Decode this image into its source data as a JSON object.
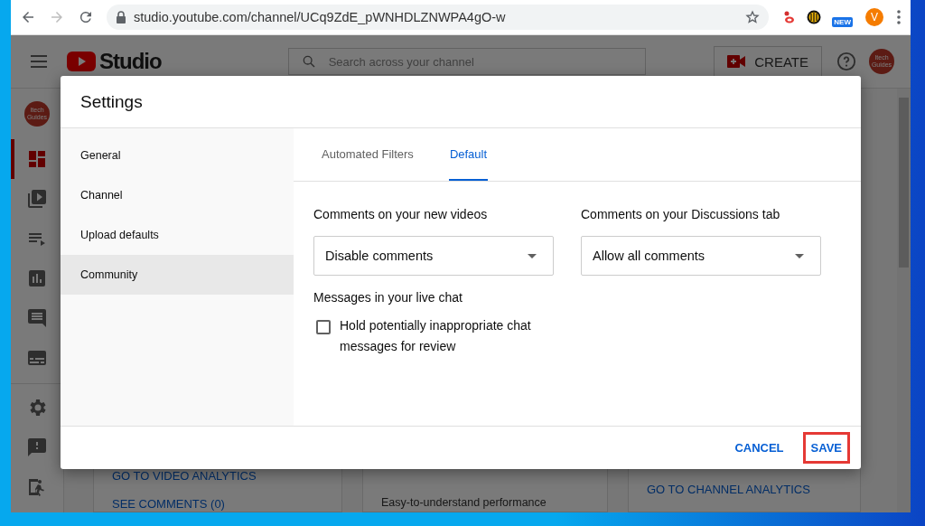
{
  "browser": {
    "url": "studio.youtube.com/channel/UCq9ZdE_pWNHDLZNWPA4gO-w",
    "extension_badge": "NEW",
    "profile_initial": "V"
  },
  "studio": {
    "logo": "Studio",
    "search": {
      "placeholder": "Search across your channel"
    },
    "create_button": "CREATE",
    "avatar_lines": [
      "Itech",
      "Guides"
    ],
    "sidebar_avatar_lines": [
      "Itech",
      "Guides"
    ],
    "nav": [
      {
        "kind": "dashboard",
        "selected": true
      },
      {
        "kind": "videos",
        "selected": false
      },
      {
        "kind": "playlists",
        "selected": false
      },
      {
        "kind": "analytics",
        "selected": false
      },
      {
        "kind": "comments",
        "selected": false
      },
      {
        "kind": "subtitles",
        "selected": false
      }
    ],
    "nav_bottom": [
      {
        "kind": "settings",
        "selected": false
      },
      {
        "kind": "feedback",
        "selected": false
      },
      {
        "kind": "exit",
        "selected": false
      }
    ],
    "cards": [
      {
        "links": [
          "GO TO VIDEO ANALYTICS",
          "SEE COMMENTS (0)"
        ]
      },
      {
        "text": "Easy-to-understand performance"
      },
      {
        "links": [
          "GO TO CHANNEL ANALYTICS"
        ]
      }
    ]
  },
  "dialog": {
    "title": "Settings",
    "menu": [
      {
        "label": "General",
        "selected": false
      },
      {
        "label": "Channel",
        "selected": false
      },
      {
        "label": "Upload defaults",
        "selected": false
      },
      {
        "label": "Community",
        "selected": true
      }
    ],
    "tabs": [
      {
        "label": "Automated Filters",
        "selected": false
      },
      {
        "label": "Default",
        "selected": true
      }
    ],
    "fields": [
      {
        "label": "Comments on your new videos",
        "value": "Disable comments"
      },
      {
        "label": "Comments on your Discussions tab",
        "value": "Allow all comments"
      }
    ],
    "live_chat": {
      "heading": "Messages in your live chat",
      "checkbox": {
        "label": "Hold potentially inappropriate chat messages for review",
        "checked": false
      }
    },
    "buttons": [
      {
        "label": "CANCEL",
        "highlighted": false
      },
      {
        "label": "SAVE",
        "highlighted": true
      }
    ]
  }
}
